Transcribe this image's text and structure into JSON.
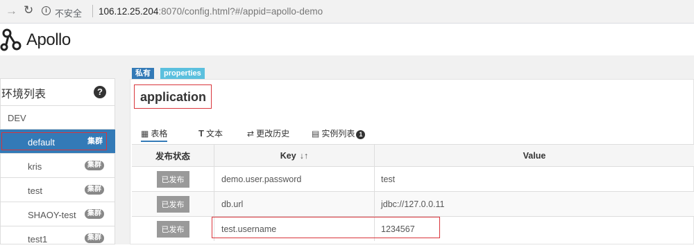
{
  "browser": {
    "insecure_label": "不安全",
    "url_host": "106.12.25.204",
    "url_rest": ":8070/config.html?#/appid=apollo-demo"
  },
  "header": {
    "brand": "Apollo"
  },
  "sidebar": {
    "title": "环境列表",
    "help_icon": "?",
    "env": "DEV",
    "clusters": [
      {
        "name": "default",
        "tag": "集群",
        "active": true
      },
      {
        "name": "kris",
        "tag": "集群"
      },
      {
        "name": "test",
        "tag": "集群"
      },
      {
        "name": "SHAOY-test",
        "tag": "集群"
      },
      {
        "name": "test1",
        "tag": "集群"
      }
    ]
  },
  "namespace": {
    "badges": {
      "private": "私有",
      "format": "properties"
    },
    "name": "application",
    "tabs": [
      {
        "icon": "table-icon",
        "label": "表格"
      },
      {
        "icon": "text-icon",
        "label": "文本"
      },
      {
        "icon": "history-icon",
        "label": "更改历史"
      },
      {
        "icon": "instances-icon",
        "label": "实例列表",
        "count": "1"
      }
    ],
    "table": {
      "headers": {
        "status": "发布状态",
        "key": "Key",
        "value": "Value"
      },
      "rows": [
        {
          "status": "已发布",
          "key": "demo.user.password",
          "value": "test"
        },
        {
          "status": "已发布",
          "key": "db.url",
          "value": "jdbc://127.0.0.11"
        },
        {
          "status": "已发布",
          "key": "test.username",
          "value": "1234567"
        }
      ]
    }
  },
  "colors": {
    "primary": "#337ab7",
    "info": "#5bc0de",
    "highlight": "#d9343a"
  }
}
